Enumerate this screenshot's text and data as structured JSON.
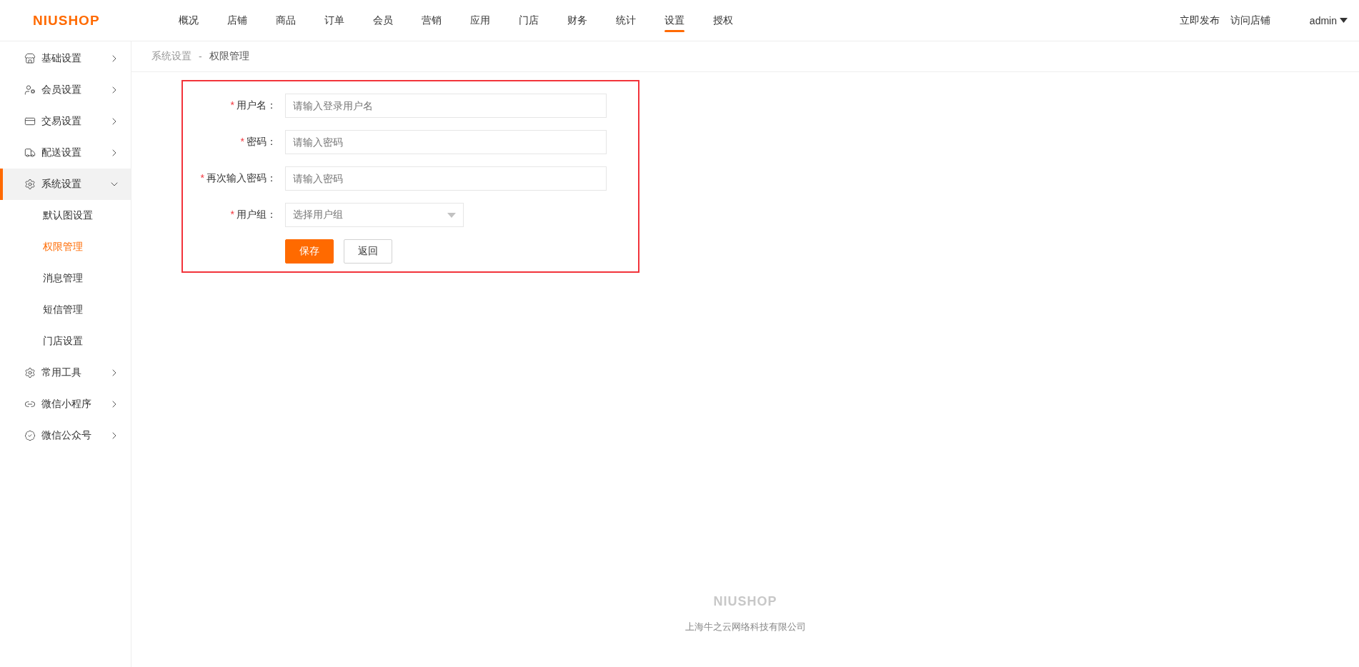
{
  "header": {
    "logo": "NIUSHOP",
    "nav": [
      {
        "label": "概况",
        "selected": false
      },
      {
        "label": "店铺",
        "selected": false
      },
      {
        "label": "商品",
        "selected": false
      },
      {
        "label": "订单",
        "selected": false
      },
      {
        "label": "会员",
        "selected": false
      },
      {
        "label": "营销",
        "selected": false
      },
      {
        "label": "应用",
        "selected": false
      },
      {
        "label": "门店",
        "selected": false
      },
      {
        "label": "财务",
        "selected": false
      },
      {
        "label": "统计",
        "selected": false
      },
      {
        "label": "设置",
        "selected": true
      },
      {
        "label": "授权",
        "selected": false
      }
    ],
    "actions": [
      "立即发布",
      "访问店铺"
    ],
    "user": "admin"
  },
  "sidebar": {
    "items": [
      {
        "label": "基础设置",
        "expanded": false
      },
      {
        "label": "会员设置",
        "expanded": false
      },
      {
        "label": "交易设置",
        "expanded": false
      },
      {
        "label": "配送设置",
        "expanded": false
      },
      {
        "label": "系统设置",
        "expanded": true,
        "children": [
          {
            "label": "默认图设置",
            "selected": false
          },
          {
            "label": "权限管理",
            "selected": true
          },
          {
            "label": "消息管理",
            "selected": false
          },
          {
            "label": "短信管理",
            "selected": false
          },
          {
            "label": "门店设置",
            "selected": false
          }
        ]
      },
      {
        "label": "常用工具",
        "expanded": false
      },
      {
        "label": "微信小程序",
        "expanded": false
      },
      {
        "label": "微信公众号",
        "expanded": false
      }
    ]
  },
  "breadcrumb": [
    "系统设置",
    "-",
    "权限管理"
  ],
  "form": {
    "fields": [
      {
        "kind": "text",
        "required_mark": "*",
        "label": "用户名：",
        "placeholder": "请输入登录用户名"
      },
      {
        "kind": "password",
        "required_mark": "*",
        "label": "密码：",
        "placeholder": "请输入密码"
      },
      {
        "kind": "password",
        "required_mark": "*",
        "label": "再次输入密码：",
        "placeholder": "请输入密码"
      },
      {
        "kind": "select",
        "required_mark": "*",
        "label": "用户组：",
        "placeholder": "选择用户组"
      }
    ],
    "buttons": [
      {
        "label": "保存",
        "kind": "primary"
      },
      {
        "label": "返回",
        "kind": "default"
      }
    ]
  },
  "footer": {
    "logo": "NIUSHOP",
    "company": "上海牛之云网络科技有限公司"
  }
}
